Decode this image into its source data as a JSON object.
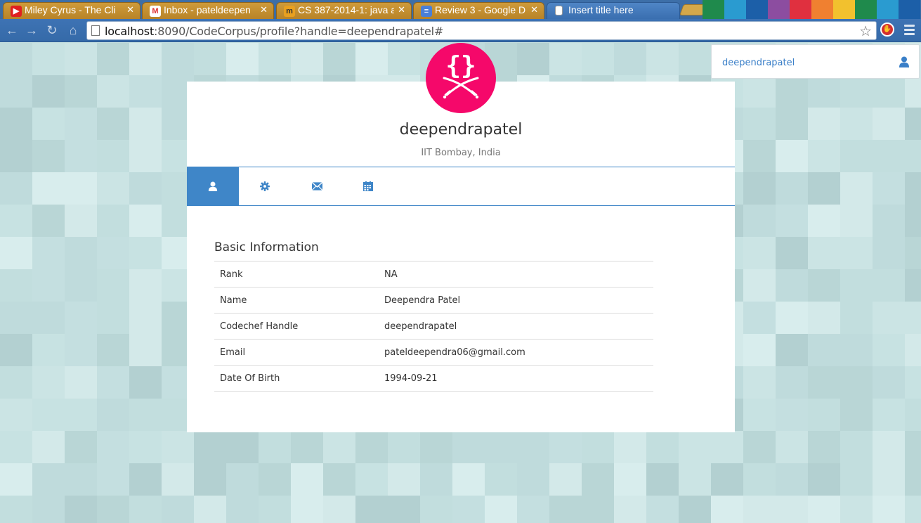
{
  "browser": {
    "tabs": [
      {
        "title": "Miley Cyrus - The Cli",
        "icon": "youtube-icon",
        "active": false
      },
      {
        "title": "Inbox - pateldeepen",
        "icon": "gmail-icon",
        "active": false
      },
      {
        "title": "CS 387-2014-1: java a",
        "icon": "moodle-icon",
        "active": false
      },
      {
        "title": "Review 3 - Google D",
        "icon": "google-docs-icon",
        "active": false
      },
      {
        "title": "Insert title here",
        "icon": "page-icon",
        "active": true
      }
    ],
    "url_host": "localhost",
    "url_rest": ":8090/CodeCorpus/profile?handle=deependrapatel#"
  },
  "header": {
    "username": "deependrapatel"
  },
  "profile": {
    "logo_text": "{}",
    "name": "deependrapatel",
    "institution": "IIT Bombay, India",
    "tabs": [
      {
        "icon": "user-icon",
        "active": true
      },
      {
        "icon": "gear-icon",
        "active": false
      },
      {
        "icon": "envelope-icon",
        "active": false
      },
      {
        "icon": "calendar-icon",
        "active": false
      }
    ]
  },
  "basic_info": {
    "title": "Basic Information",
    "rows": [
      {
        "label": "Rank",
        "value": "NA"
      },
      {
        "label": "Name",
        "value": "Deependra Patel"
      },
      {
        "label": "Codechef Handle",
        "value": "deependrapatel"
      },
      {
        "label": "Email",
        "value": "pateldeependra06@gmail.com"
      },
      {
        "label": "Date Of Birth",
        "value": "1994-09-21"
      }
    ]
  },
  "colors": {
    "accent": "#3f86c8",
    "logo": "#f5086a",
    "chip_text": "#3a7fc8"
  }
}
